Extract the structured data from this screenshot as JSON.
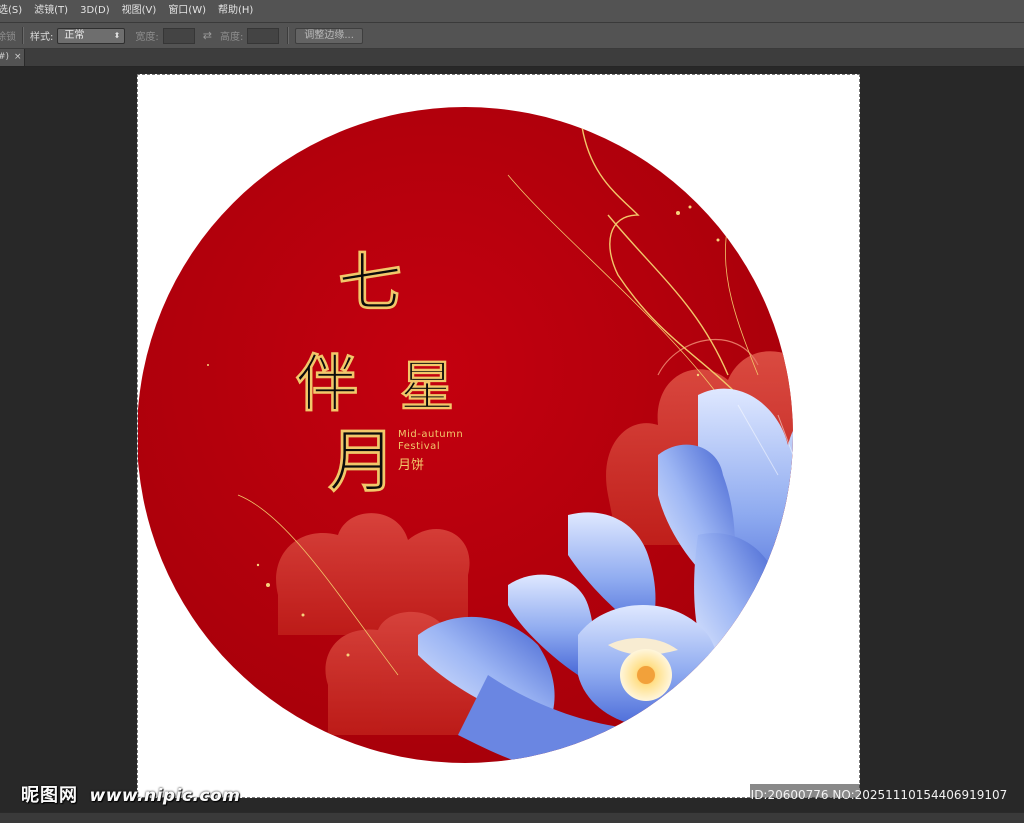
{
  "menu": {
    "items": [
      {
        "label": "选(S)"
      },
      {
        "label": "滤镜(T)"
      },
      {
        "label": "3D(D)"
      },
      {
        "label": "视图(V)"
      },
      {
        "label": "窗口(W)"
      },
      {
        "label": "帮助(H)"
      }
    ]
  },
  "options": {
    "feather_fragment": "除锁",
    "style_label": "样式:",
    "style_value": "正常",
    "width_label": "宽度:",
    "height_label": "高度:",
    "refine_edge_label": "调整边缘..."
  },
  "tab": {
    "title_fragment": "#)",
    "close": "×"
  },
  "artwork": {
    "calligraphy": "七星伴月",
    "english_line1": "Mid-autumn",
    "english_line2": "Festival",
    "chinese_small": "月饼",
    "colors": {
      "red": "#b8000c",
      "gold": "#f2c76a",
      "petal_blue": "#5e82e6",
      "petal_light": "#dbe6ff"
    }
  },
  "watermark": {
    "brand": "昵图网",
    "url": "www.nipic.com",
    "id_text": "ID:20600776 NO:20251110154406919107"
  }
}
